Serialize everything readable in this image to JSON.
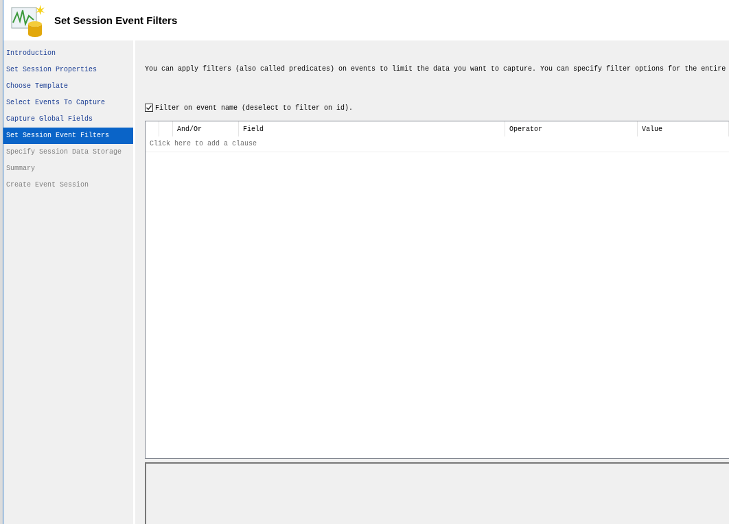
{
  "header": {
    "title": "Set Session Event Filters"
  },
  "sidebar": {
    "items": [
      {
        "label": "Introduction",
        "visited": true,
        "selected": false
      },
      {
        "label": "Set Session Properties",
        "visited": true,
        "selected": false
      },
      {
        "label": "Choose Template",
        "visited": true,
        "selected": false
      },
      {
        "label": "Select Events To Capture",
        "visited": true,
        "selected": false
      },
      {
        "label": "Capture Global Fields",
        "visited": true,
        "selected": false
      },
      {
        "label": "Set Session Event Filters",
        "visited": true,
        "selected": true
      },
      {
        "label": "Specify Session Data Storage",
        "visited": false,
        "selected": false
      },
      {
        "label": "Summary",
        "visited": false,
        "selected": false
      },
      {
        "label": "Create Event Session",
        "visited": false,
        "selected": false
      }
    ]
  },
  "description": "You can apply filters (also called predicates) on events to limit the data you want to capture. You can specify filter options for the entire",
  "filter_checkbox": {
    "label": "Filter on event name (deselect to filter on id).",
    "checked": true
  },
  "grid": {
    "columns": [
      "And/Or",
      "Field",
      "Operator",
      "Value"
    ],
    "add_row": "Click here to add a clause"
  }
}
